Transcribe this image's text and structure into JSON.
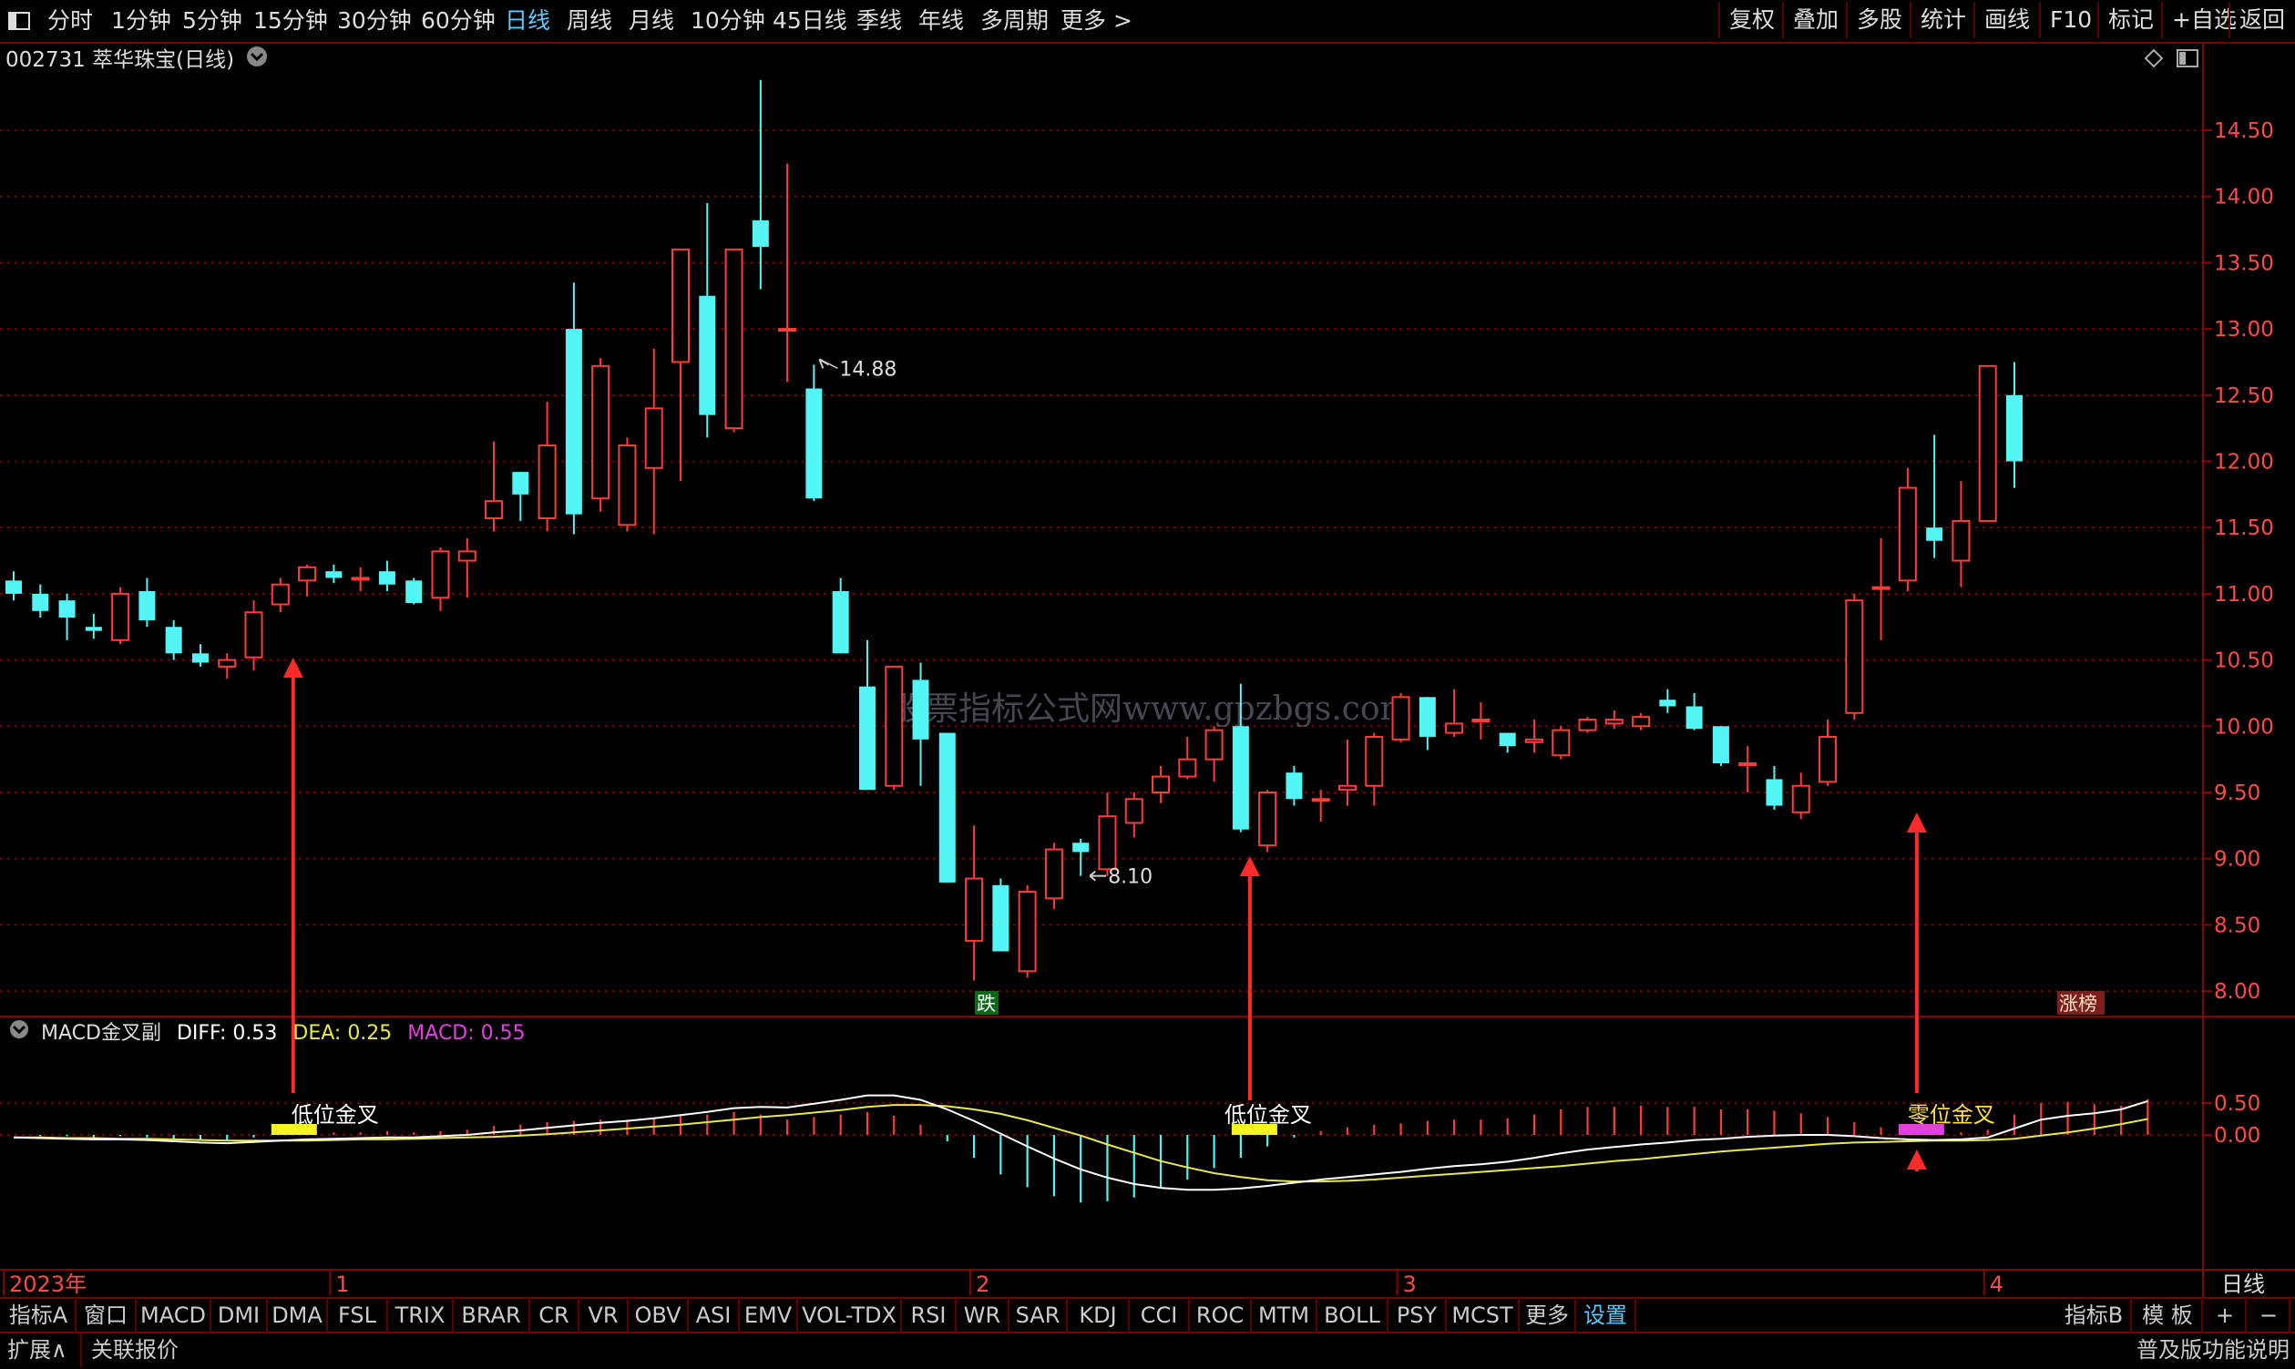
{
  "toolbar": {
    "periods": [
      "分时",
      "1分钟",
      "5分钟",
      "15分钟",
      "30分钟",
      "60分钟",
      "日线",
      "周线",
      "月线",
      "10分钟",
      "45日线",
      "季线",
      "年线",
      "多周期",
      "更多 >"
    ],
    "active_period": "日线",
    "right_buttons": [
      "复权",
      "叠加",
      "多股",
      "统计",
      "画线",
      "F10",
      "标记",
      "+自选",
      "返回"
    ]
  },
  "stock": {
    "title": "002731 萃华珠宝(日线)"
  },
  "watermark": "股票指标公式网www.gpzbgs.com",
  "indicator": {
    "name": "MACD金叉副",
    "diff_label": "DIFF:",
    "diff_value": "0.53",
    "dea_label": "DEA:",
    "dea_value": "0.25",
    "macd_label": "MACD:",
    "macd_value": "0.55"
  },
  "signals": {
    "low_cross_label": "低位金叉",
    "near_zero_label": "零位金叉",
    "limit_down_badge": "跌",
    "limit_up_badge": "涨榜"
  },
  "colors": {
    "up": "#ff3b3b",
    "down": "#54f5f5",
    "diff_line": "#ffffff",
    "dea_line": "#e8e84a",
    "macd_text": "#e040e0",
    "grid": "#8a0000",
    "arrow": "#ff2a2a"
  },
  "bottom_tabs": [
    "指标A",
    "窗口",
    "MACD",
    "DMI",
    "DMA",
    "FSL",
    "TRIX",
    "BRAR",
    "CR",
    "VR",
    "OBV",
    "ASI",
    "EMV",
    "VOL-TDX",
    "RSI",
    "WR",
    "SAR",
    "KDJ",
    "CCI",
    "ROC",
    "MTM",
    "BOLL",
    "PSY",
    "MCST",
    "更多",
    "设置"
  ],
  "active_tab": "设置",
  "right_tabs": [
    "指标B",
    "模 板",
    "+",
    "−"
  ],
  "status": {
    "expand": "扩展∧",
    "related": "关联报价",
    "edition": "普及版功能说明"
  },
  "chart_data": {
    "type": "candlestick",
    "price_axis": {
      "ticks": [
        "14.50",
        "14.00",
        "13.50",
        "13.00",
        "12.50",
        "12.00",
        "11.50",
        "11.00",
        "10.50",
        "10.00",
        "9.50",
        "9.00",
        "8.50",
        "8.00"
      ],
      "range": [
        7.8,
        15.0
      ]
    },
    "macd_axis": {
      "ticks": [
        "0.50",
        "0.00"
      ],
      "range": [
        -1.05,
        0.72
      ]
    },
    "time_axis": {
      "labels": [
        "2023年",
        "1",
        "2",
        "3",
        "4"
      ],
      "positions": [
        0,
        12,
        36,
        52,
        74
      ],
      "period_label": "日线"
    },
    "high_mark": {
      "index": 30,
      "label": "14.88"
    },
    "low_mark": {
      "index": 40,
      "label": "8.10"
    },
    "candles": [
      {
        "o": 11.1,
        "h": 11.17,
        "l": 10.95,
        "c": 11.0
      },
      {
        "o": 11.0,
        "h": 11.07,
        "l": 10.82,
        "c": 10.87
      },
      {
        "o": 10.95,
        "h": 11.0,
        "l": 10.65,
        "c": 10.82
      },
      {
        "o": 10.75,
        "h": 10.85,
        "l": 10.66,
        "c": 10.72
      },
      {
        "o": 10.65,
        "h": 11.05,
        "l": 10.62,
        "c": 11.0
      },
      {
        "o": 11.02,
        "h": 11.12,
        "l": 10.75,
        "c": 10.8
      },
      {
        "o": 10.75,
        "h": 10.8,
        "l": 10.5,
        "c": 10.55
      },
      {
        "o": 10.55,
        "h": 10.62,
        "l": 10.45,
        "c": 10.48
      },
      {
        "o": 10.45,
        "h": 10.55,
        "l": 10.36,
        "c": 10.5
      },
      {
        "o": 10.52,
        "h": 10.95,
        "l": 10.42,
        "c": 10.86
      },
      {
        "o": 10.92,
        "h": 11.12,
        "l": 10.86,
        "c": 11.07
      },
      {
        "o": 11.1,
        "h": 11.22,
        "l": 10.98,
        "c": 11.2
      },
      {
        "o": 11.17,
        "h": 11.22,
        "l": 11.08,
        "c": 11.12
      },
      {
        "o": 11.12,
        "h": 11.2,
        "l": 11.02,
        "c": 11.12
      },
      {
        "o": 11.17,
        "h": 11.25,
        "l": 11.02,
        "c": 11.07
      },
      {
        "o": 11.1,
        "h": 11.12,
        "l": 10.92,
        "c": 10.93
      },
      {
        "o": 10.97,
        "h": 11.35,
        "l": 10.87,
        "c": 11.32
      },
      {
        "o": 11.25,
        "h": 11.42,
        "l": 10.97,
        "c": 11.32
      },
      {
        "o": 11.57,
        "h": 12.15,
        "l": 11.47,
        "c": 11.7
      },
      {
        "o": 11.92,
        "h": 11.92,
        "l": 11.55,
        "c": 11.75
      },
      {
        "o": 11.57,
        "h": 12.45,
        "l": 11.47,
        "c": 12.12
      },
      {
        "o": 13.0,
        "h": 13.35,
        "l": 11.45,
        "c": 11.6
      },
      {
        "o": 11.72,
        "h": 12.78,
        "l": 11.62,
        "c": 12.72
      },
      {
        "o": 11.52,
        "h": 12.18,
        "l": 11.47,
        "c": 12.12
      },
      {
        "o": 11.95,
        "h": 12.85,
        "l": 11.45,
        "c": 12.4
      },
      {
        "o": 12.75,
        "h": 13.6,
        "l": 11.85,
        "c": 13.6
      },
      {
        "o": 13.25,
        "h": 13.95,
        "l": 12.18,
        "c": 12.35
      },
      {
        "o": 12.25,
        "h": 13.58,
        "l": 12.22,
        "c": 13.6
      },
      {
        "o": 13.82,
        "h": 14.88,
        "l": 13.3,
        "c": 13.62
      },
      {
        "o": 13.0,
        "h": 14.25,
        "l": 12.6,
        "c": 13.0
      },
      {
        "o": 12.55,
        "h": 12.73,
        "l": 11.7,
        "c": 11.72
      },
      {
        "o": 11.02,
        "h": 11.12,
        "l": 10.55,
        "c": 10.55
      },
      {
        "o": 10.3,
        "h": 10.65,
        "l": 9.52,
        "c": 9.52
      },
      {
        "o": 9.55,
        "h": 10.45,
        "l": 9.52,
        "c": 10.45
      },
      {
        "o": 10.35,
        "h": 10.48,
        "l": 9.55,
        "c": 9.9
      },
      {
        "o": 9.95,
        "h": 9.95,
        "l": 8.82,
        "c": 8.82
      },
      {
        "o": 8.38,
        "h": 9.25,
        "l": 8.08,
        "c": 8.85
      },
      {
        "o": 8.8,
        "h": 8.85,
        "l": 8.3,
        "c": 8.3
      },
      {
        "o": 8.15,
        "h": 8.8,
        "l": 8.1,
        "c": 8.75
      },
      {
        "o": 8.7,
        "h": 9.12,
        "l": 8.62,
        "c": 9.07
      },
      {
        "o": 9.12,
        "h": 9.15,
        "l": 8.87,
        "c": 9.05
      },
      {
        "o": 8.92,
        "h": 9.5,
        "l": 8.87,
        "c": 9.32
      },
      {
        "o": 9.27,
        "h": 9.5,
        "l": 9.16,
        "c": 9.45
      },
      {
        "o": 9.5,
        "h": 9.7,
        "l": 9.42,
        "c": 9.62
      },
      {
        "o": 9.62,
        "h": 9.92,
        "l": 9.6,
        "c": 9.75
      },
      {
        "o": 9.75,
        "h": 10.0,
        "l": 9.58,
        "c": 9.97
      },
      {
        "o": 10.0,
        "h": 10.32,
        "l": 9.2,
        "c": 9.22
      },
      {
        "o": 9.1,
        "h": 9.52,
        "l": 9.05,
        "c": 9.5
      },
      {
        "o": 9.65,
        "h": 9.7,
        "l": 9.4,
        "c": 9.45
      },
      {
        "o": 9.45,
        "h": 9.52,
        "l": 9.28,
        "c": 9.45
      },
      {
        "o": 9.52,
        "h": 9.9,
        "l": 9.4,
        "c": 9.55
      },
      {
        "o": 9.55,
        "h": 9.95,
        "l": 9.4,
        "c": 9.92
      },
      {
        "o": 9.9,
        "h": 10.25,
        "l": 9.88,
        "c": 10.22
      },
      {
        "o": 10.22,
        "h": 10.22,
        "l": 9.82,
        "c": 9.92
      },
      {
        "o": 9.95,
        "h": 10.28,
        "l": 9.92,
        "c": 10.02
      },
      {
        "o": 10.05,
        "h": 10.18,
        "l": 9.9,
        "c": 10.05
      },
      {
        "o": 9.95,
        "h": 9.95,
        "l": 9.8,
        "c": 9.85
      },
      {
        "o": 9.88,
        "h": 10.05,
        "l": 9.8,
        "c": 9.9
      },
      {
        "o": 9.78,
        "h": 10.0,
        "l": 9.75,
        "c": 9.97
      },
      {
        "o": 9.97,
        "h": 10.07,
        "l": 9.95,
        "c": 10.05
      },
      {
        "o": 10.02,
        "h": 10.12,
        "l": 9.98,
        "c": 10.05
      },
      {
        "o": 10.0,
        "h": 10.1,
        "l": 9.97,
        "c": 10.07
      },
      {
        "o": 10.2,
        "h": 10.28,
        "l": 10.1,
        "c": 10.15
      },
      {
        "o": 10.15,
        "h": 10.25,
        "l": 9.97,
        "c": 9.98
      },
      {
        "o": 10.0,
        "h": 10.0,
        "l": 9.7,
        "c": 9.72
      },
      {
        "o": 9.72,
        "h": 9.85,
        "l": 9.5,
        "c": 9.72
      },
      {
        "o": 9.6,
        "h": 9.7,
        "l": 9.37,
        "c": 9.4
      },
      {
        "o": 9.35,
        "h": 9.65,
        "l": 9.3,
        "c": 9.55
      },
      {
        "o": 9.58,
        "h": 10.05,
        "l": 9.55,
        "c": 9.92
      },
      {
        "o": 10.1,
        "h": 11.0,
        "l": 10.05,
        "c": 10.95
      },
      {
        "o": 11.05,
        "h": 11.42,
        "l": 10.65,
        "c": 11.05
      },
      {
        "o": 11.1,
        "h": 11.95,
        "l": 11.02,
        "c": 11.8
      },
      {
        "o": 11.5,
        "h": 12.2,
        "l": 11.27,
        "c": 11.4
      },
      {
        "o": 11.25,
        "h": 11.85,
        "l": 11.05,
        "c": 11.55
      },
      {
        "o": 11.55,
        "h": 12.72,
        "l": 11.55,
        "c": 12.72
      },
      {
        "o": 12.5,
        "h": 12.75,
        "l": 11.8,
        "c": 12.0
      }
    ],
    "diff": [
      -0.04,
      -0.05,
      -0.06,
      -0.07,
      -0.07,
      -0.08,
      -0.1,
      -0.12,
      -0.13,
      -0.11,
      -0.09,
      -0.07,
      -0.06,
      -0.05,
      -0.04,
      -0.04,
      -0.02,
      0.0,
      0.04,
      0.07,
      0.11,
      0.15,
      0.19,
      0.22,
      0.26,
      0.31,
      0.36,
      0.42,
      0.44,
      0.43,
      0.49,
      0.55,
      0.62,
      0.62,
      0.55,
      0.4,
      0.22,
      0.02,
      -0.18,
      -0.37,
      -0.54,
      -0.67,
      -0.77,
      -0.83,
      -0.86,
      -0.86,
      -0.84,
      -0.8,
      -0.75,
      -0.7,
      -0.66,
      -0.62,
      -0.58,
      -0.53,
      -0.49,
      -0.46,
      -0.42,
      -0.36,
      -0.29,
      -0.23,
      -0.19,
      -0.15,
      -0.12,
      -0.08,
      -0.06,
      -0.03,
      -0.01,
      0.0,
      0.0,
      -0.02,
      -0.05,
      -0.07,
      -0.08,
      -0.07,
      -0.04,
      0.1,
      0.24,
      0.3,
      0.34,
      0.4,
      0.53
    ],
    "dea": [
      -0.04,
      -0.04,
      -0.05,
      -0.05,
      -0.06,
      -0.06,
      -0.07,
      -0.08,
      -0.09,
      -0.09,
      -0.09,
      -0.09,
      -0.08,
      -0.07,
      -0.07,
      -0.06,
      -0.05,
      -0.04,
      -0.03,
      -0.01,
      0.01,
      0.04,
      0.07,
      0.1,
      0.13,
      0.16,
      0.2,
      0.24,
      0.28,
      0.31,
      0.35,
      0.39,
      0.44,
      0.47,
      0.47,
      0.45,
      0.4,
      0.33,
      0.23,
      0.11,
      -0.01,
      -0.15,
      -0.28,
      -0.41,
      -0.51,
      -0.6,
      -0.66,
      -0.71,
      -0.73,
      -0.73,
      -0.72,
      -0.7,
      -0.67,
      -0.64,
      -0.61,
      -0.58,
      -0.55,
      -0.52,
      -0.49,
      -0.45,
      -0.41,
      -0.38,
      -0.34,
      -0.3,
      -0.26,
      -0.23,
      -0.2,
      -0.17,
      -0.14,
      -0.12,
      -0.11,
      -0.1,
      -0.09,
      -0.09,
      -0.08,
      -0.06,
      -0.01,
      0.04,
      0.1,
      0.17,
      0.25
    ],
    "golden_cross_indices": [
      10,
      46,
      71
    ]
  }
}
